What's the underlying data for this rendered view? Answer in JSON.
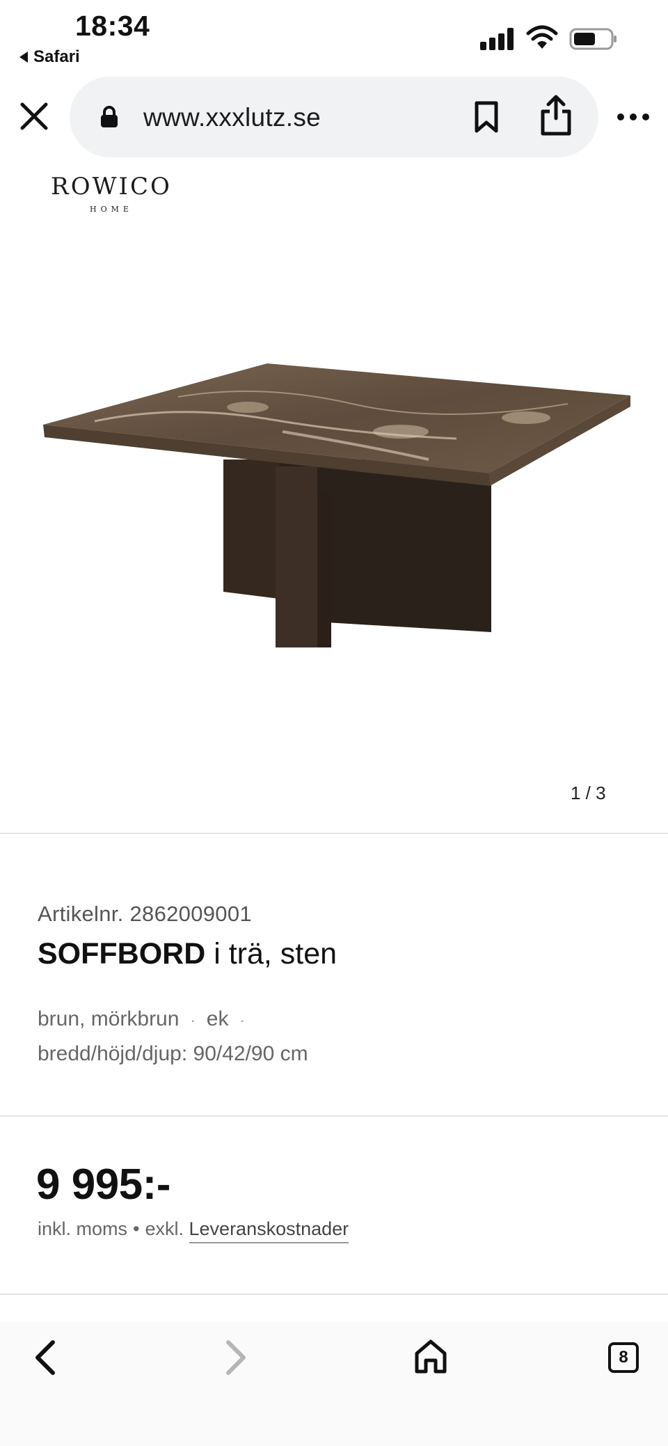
{
  "status_bar": {
    "time": "18:34",
    "back_app": "Safari",
    "icons": [
      "signal-icon",
      "wifi-icon",
      "battery-icon"
    ]
  },
  "browser": {
    "url": "www.xxxlutz.se",
    "icons": [
      "close-icon",
      "lock-icon",
      "bookmark-icon",
      "share-icon",
      "more-icon"
    ]
  },
  "brand": {
    "name": "ROWICO",
    "sub": "HOME"
  },
  "gallery": {
    "counter": "1 / 3"
  },
  "product": {
    "article_nr": "Artikelnr. 2862009001",
    "title_bold": "SOFFBORD",
    "title_rest": " i trä, sten",
    "color": "brun, mörkbrun",
    "material": "ek",
    "separator": "·",
    "dimensions": "bredd/höjd/djup: 90/42/90 cm"
  },
  "price": {
    "amount": "9 995:-",
    "incl": "inkl. moms",
    "bullet": "•",
    "excl": "exkl.",
    "link": "Leveranskostnader"
  },
  "toolbar": {
    "tabs_count": "8",
    "icons": [
      "back-icon",
      "forward-icon",
      "home-icon",
      "tabs-icon"
    ]
  },
  "colors": {
    "accent": "#111111",
    "pill_bg": "#f1f2f4",
    "marble": "#6b5a48",
    "wood": "#3b2e28"
  }
}
